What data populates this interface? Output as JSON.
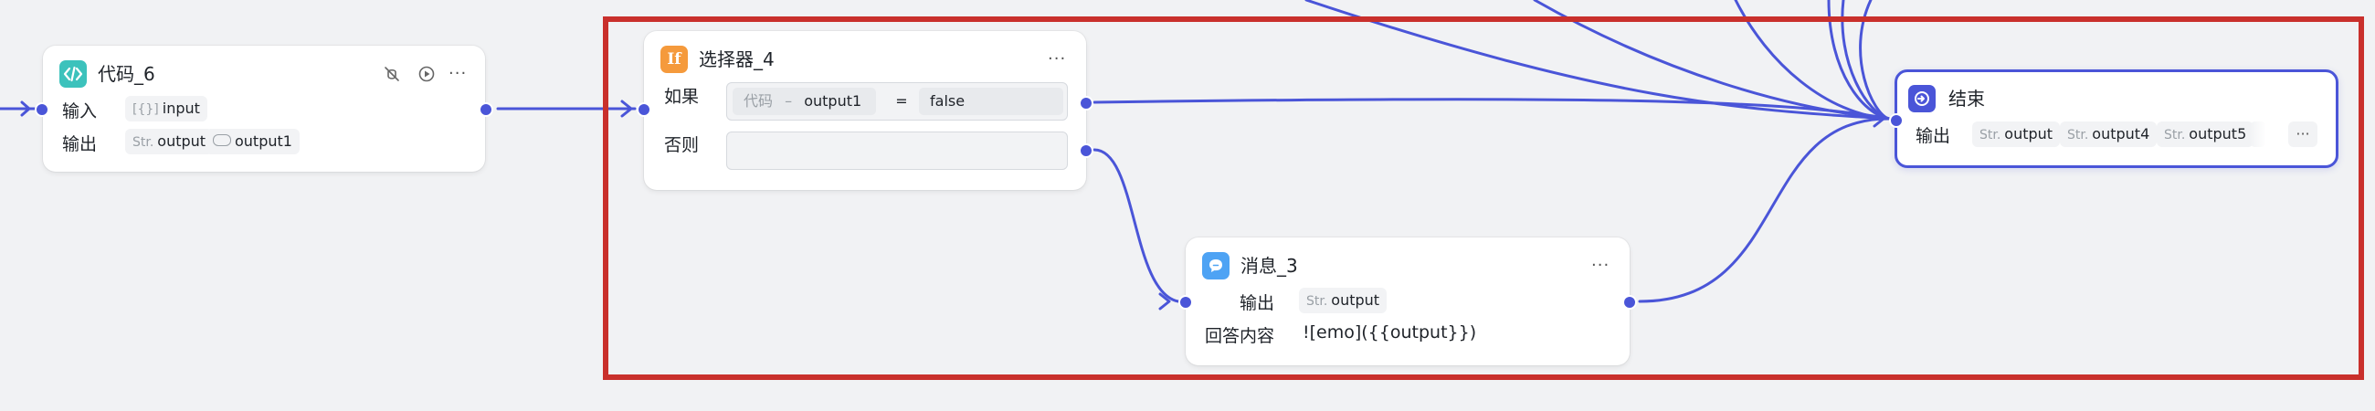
{
  "nodes": {
    "code": {
      "title": "代码_6",
      "input_label": "输入",
      "output_label": "输出",
      "input_tag_prefix": "[{}]",
      "input_tag": "input",
      "output_tag_prefix": "Str.",
      "output_tag": "output",
      "output_tag2": "output1",
      "icon": "code-icon"
    },
    "selector": {
      "title": "选择器_4",
      "if_label": "如果",
      "else_label": "否则",
      "cond_source": "代码",
      "cond_dash": "–",
      "cond_var": "output1",
      "cond_op": "=",
      "cond_value": "false",
      "icon": "if-icon"
    },
    "message": {
      "title": "消息_3",
      "output_label": "输出",
      "output_tag_prefix": "Str.",
      "output_tag": "output",
      "answer_label": "回答内容",
      "answer_value": "![emo]({{output}})",
      "icon": "chat-bubble-icon"
    },
    "end": {
      "title": "结束",
      "output_label": "输出",
      "prefix": "Str.",
      "tags": [
        "output",
        "output4",
        "output5"
      ],
      "icon": "end-icon"
    }
  },
  "colors": {
    "accent": "#4a55d8",
    "highlight": "#c9302c",
    "code_icon": "#3cc2bc",
    "if_icon": "#f59a3c",
    "message_icon": "#4ea3f4",
    "end_icon": "#4a55d8"
  }
}
